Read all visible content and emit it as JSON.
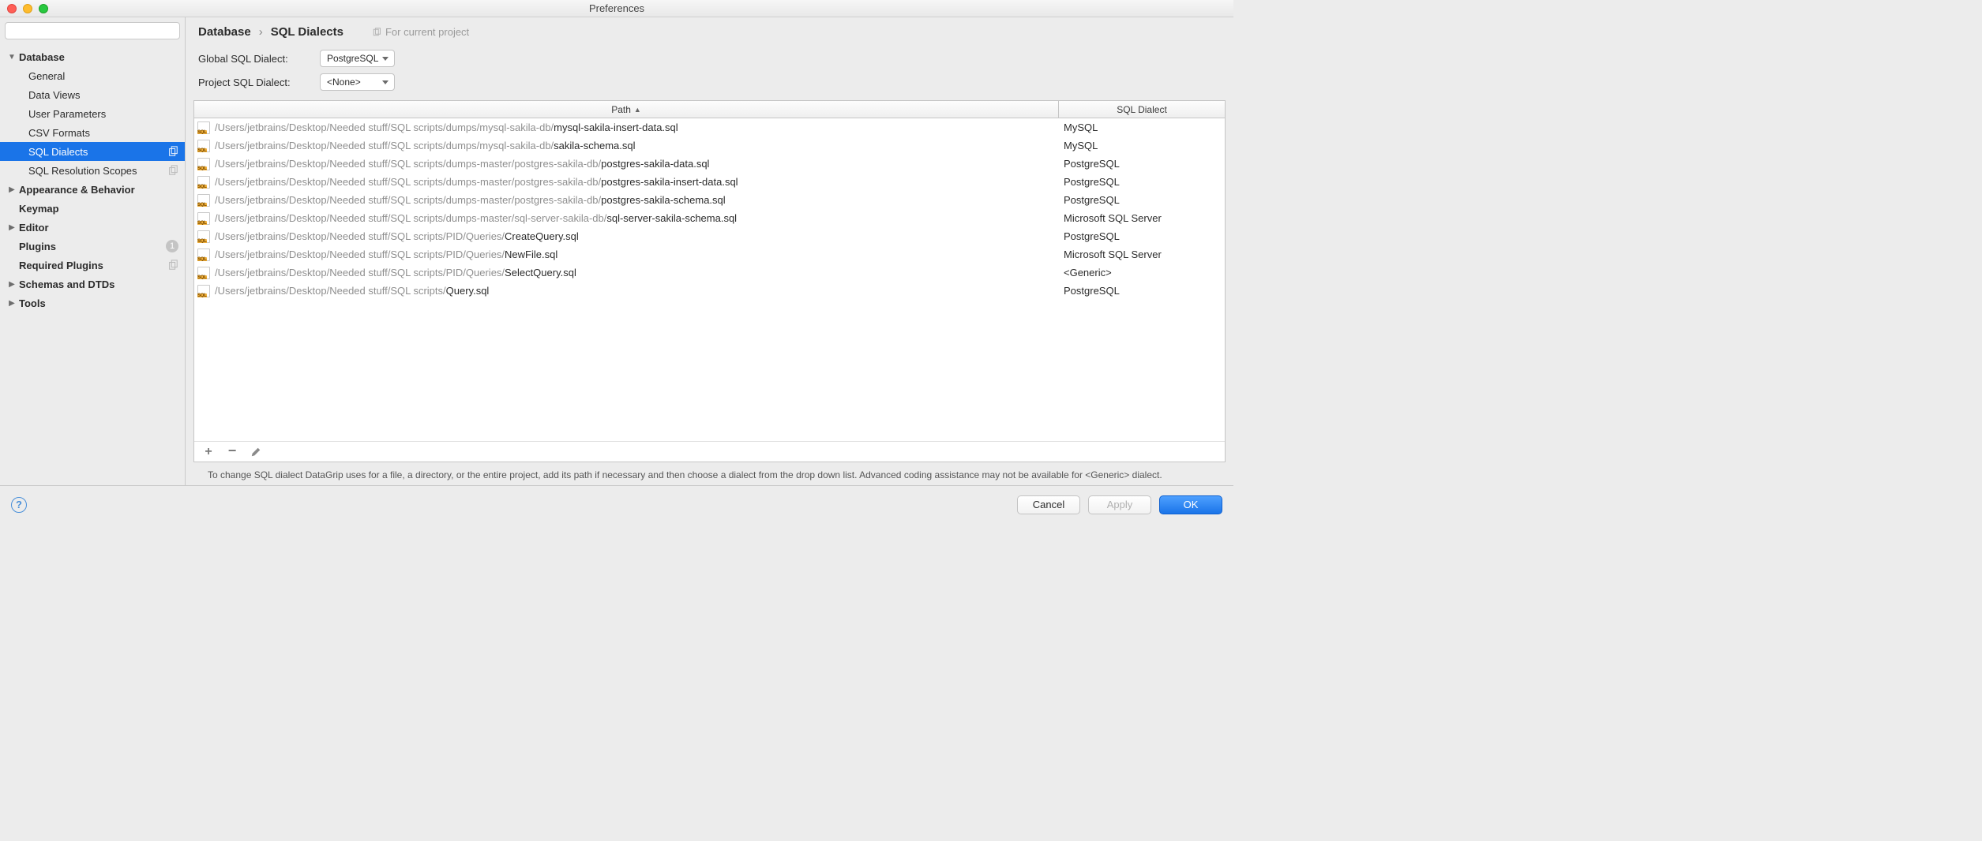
{
  "window": {
    "title": "Preferences"
  },
  "search": {
    "placeholder": ""
  },
  "sidebar": {
    "groups": [
      {
        "label": "Database",
        "expanded": true,
        "children": [
          {
            "label": "General"
          },
          {
            "label": "Data Views"
          },
          {
            "label": "User Parameters"
          },
          {
            "label": "CSV Formats"
          },
          {
            "label": "SQL Dialects",
            "selected": true,
            "copy": true
          },
          {
            "label": "SQL Resolution Scopes",
            "copy": true
          }
        ]
      },
      {
        "label": "Appearance & Behavior",
        "expanded": false
      },
      {
        "label": "Keymap",
        "leaf": true
      },
      {
        "label": "Editor",
        "expanded": false
      },
      {
        "label": "Plugins",
        "leaf": true,
        "badge": "1"
      },
      {
        "label": "Required Plugins",
        "leaf": true,
        "copy": true
      },
      {
        "label": "Schemas and DTDs",
        "expanded": false
      },
      {
        "label": "Tools",
        "expanded": false
      }
    ]
  },
  "breadcrumb": {
    "root": "Database",
    "leaf": "SQL Dialects",
    "scope": "For current project"
  },
  "form": {
    "global_label": "Global SQL Dialect:",
    "global_value": "PostgreSQL",
    "project_label": "Project SQL Dialect:",
    "project_value": "<None>"
  },
  "table": {
    "headers": {
      "path": "Path",
      "dialect": "SQL Dialect"
    },
    "rows": [
      {
        "dir": "/Users/jetbrains/Desktop/Needed stuff/SQL scripts/dumps/mysql-sakila-db/",
        "file": "mysql-sakila-insert-data.sql",
        "dialect": "MySQL"
      },
      {
        "dir": "/Users/jetbrains/Desktop/Needed stuff/SQL scripts/dumps/mysql-sakila-db/",
        "file": "sakila-schema.sql",
        "dialect": "MySQL"
      },
      {
        "dir": "/Users/jetbrains/Desktop/Needed stuff/SQL scripts/dumps-master/postgres-sakila-db/",
        "file": "postgres-sakila-data.sql",
        "dialect": "PostgreSQL"
      },
      {
        "dir": "/Users/jetbrains/Desktop/Needed stuff/SQL scripts/dumps-master/postgres-sakila-db/",
        "file": "postgres-sakila-insert-data.sql",
        "dialect": "PostgreSQL"
      },
      {
        "dir": "/Users/jetbrains/Desktop/Needed stuff/SQL scripts/dumps-master/postgres-sakila-db/",
        "file": "postgres-sakila-schema.sql",
        "dialect": "PostgreSQL"
      },
      {
        "dir": "/Users/jetbrains/Desktop/Needed stuff/SQL scripts/dumps-master/sql-server-sakila-db/",
        "file": "sql-server-sakila-schema.sql",
        "dialect": "Microsoft SQL Server"
      },
      {
        "dir": "/Users/jetbrains/Desktop/Needed stuff/SQL scripts/PID/Queries/",
        "file": "CreateQuery.sql",
        "dialect": "PostgreSQL"
      },
      {
        "dir": "/Users/jetbrains/Desktop/Needed stuff/SQL scripts/PID/Queries/",
        "file": "NewFile.sql",
        "dialect": "Microsoft SQL Server"
      },
      {
        "dir": "/Users/jetbrains/Desktop/Needed stuff/SQL scripts/PID/Queries/",
        "file": "SelectQuery.sql",
        "dialect": "<Generic>"
      },
      {
        "dir": "/Users/jetbrains/Desktop/Needed stuff/SQL scripts/",
        "file": "Query.sql",
        "dialect": "PostgreSQL"
      }
    ]
  },
  "hint": "To change SQL dialect DataGrip uses for a file, a directory, or the entire project, add its path if necessary and then choose a dialect from the drop down list. Advanced coding assistance may not be available for <Generic> dialect.",
  "footer": {
    "cancel": "Cancel",
    "apply": "Apply",
    "ok": "OK"
  }
}
